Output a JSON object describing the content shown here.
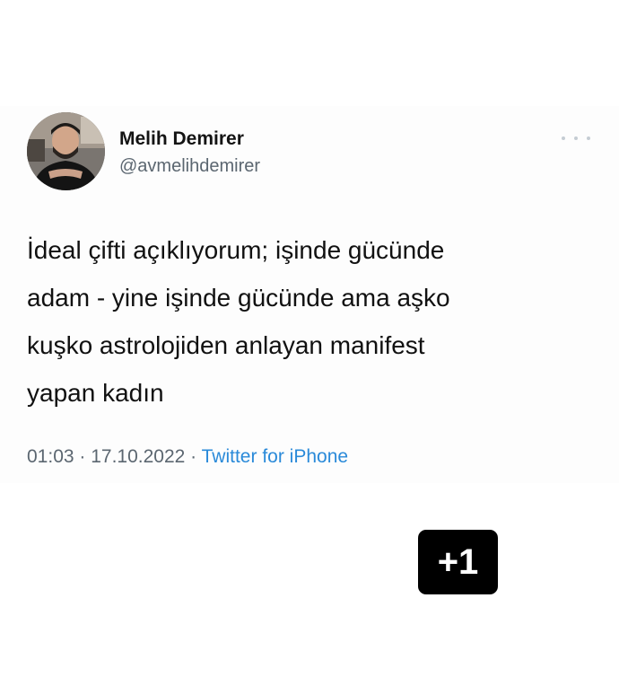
{
  "tweet": {
    "display_name": "Melih Demirer",
    "handle": "@avmelihdemirer",
    "text": "İdeal çifti açıklıyorum; işinde gücünde\nadam - yine işinde gücünde ama aşko\nkuşko astrolojiden anlayan manifest\nyapan kadın",
    "time": "01:03",
    "separator": " · ",
    "date": "17.10.2022",
    "source": "Twitter for iPhone",
    "more_icon": "ellipsis-icon",
    "source_color": "#2a8ad9"
  },
  "overlay": {
    "badge_label": "+1"
  }
}
